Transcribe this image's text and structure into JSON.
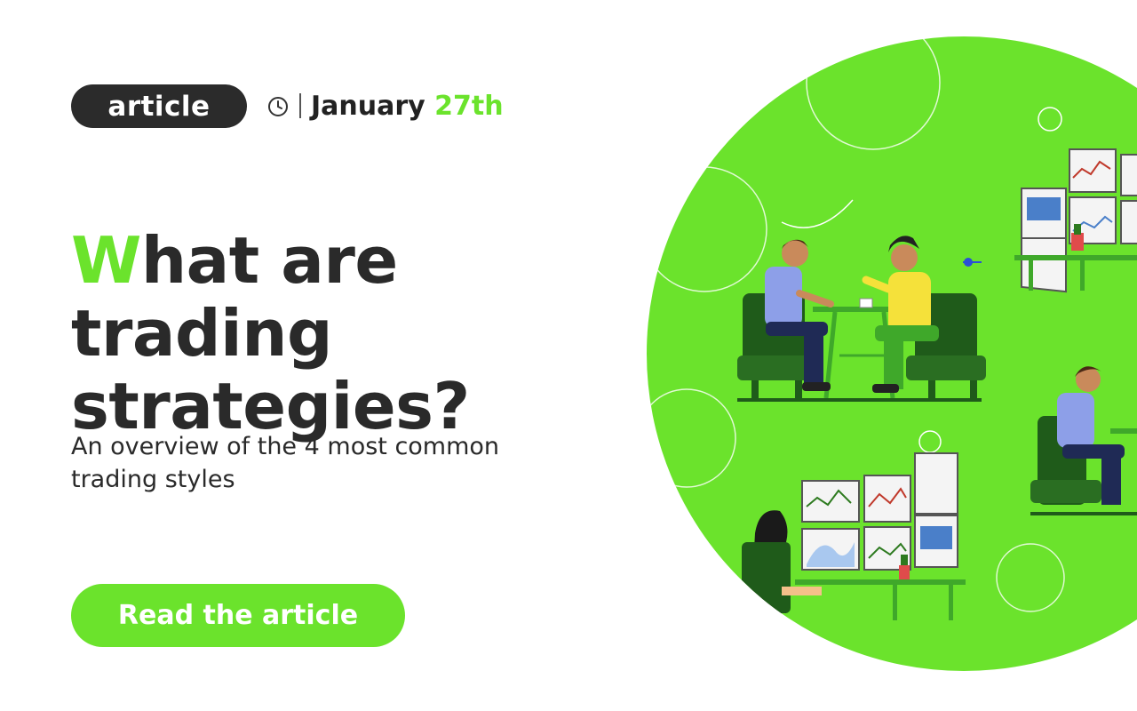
{
  "tag": {
    "label": "article"
  },
  "date": {
    "month": "January",
    "day": "27th"
  },
  "headline": {
    "first_letter": "W",
    "rest_line1": "hat are trading",
    "line2": "strategies?"
  },
  "subtitle": "An overview of the 4 most common trading styles",
  "cta": {
    "label": "Read the article"
  },
  "colors": {
    "accent": "#6be32c",
    "dark": "#2b2b2b",
    "text": "#222222",
    "background": "#ffffff"
  },
  "icons": [
    "clock-icon"
  ],
  "illustration": {
    "subject": "people trading at desks with chart monitors on a green circle"
  }
}
